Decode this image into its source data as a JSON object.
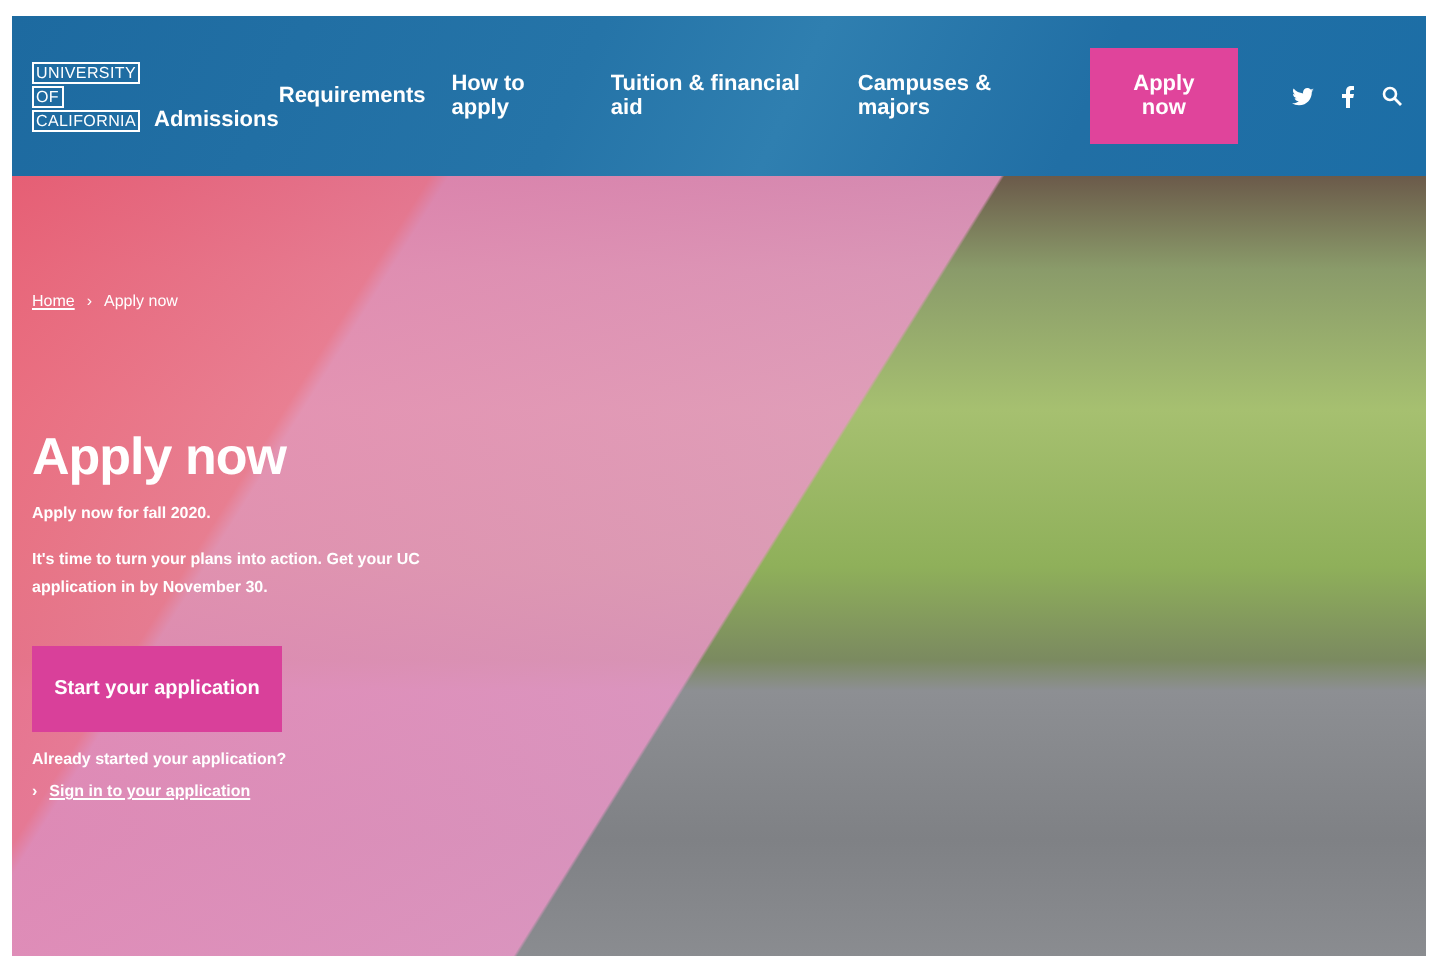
{
  "header": {
    "logo_lines": [
      "UNIVERSITY",
      "OF",
      "CALIFORNIA"
    ],
    "section": "Admissions",
    "nav": [
      "Requirements",
      "How to apply",
      "Tuition & financial aid",
      "Campuses & majors"
    ],
    "cta": "Apply now"
  },
  "hero": {
    "breadcrumb": [
      "Home",
      "Apply now"
    ],
    "breadcrumb_separator": "›",
    "title": "Apply now",
    "subtitle": "Apply now for fall 2020.",
    "body": "It's time to turn your plans into action. Get your UC application in by November 30.",
    "button": "Start your application",
    "prompt": "Already started your application?",
    "link_marker": "›",
    "link": "Sign in to your application"
  }
}
